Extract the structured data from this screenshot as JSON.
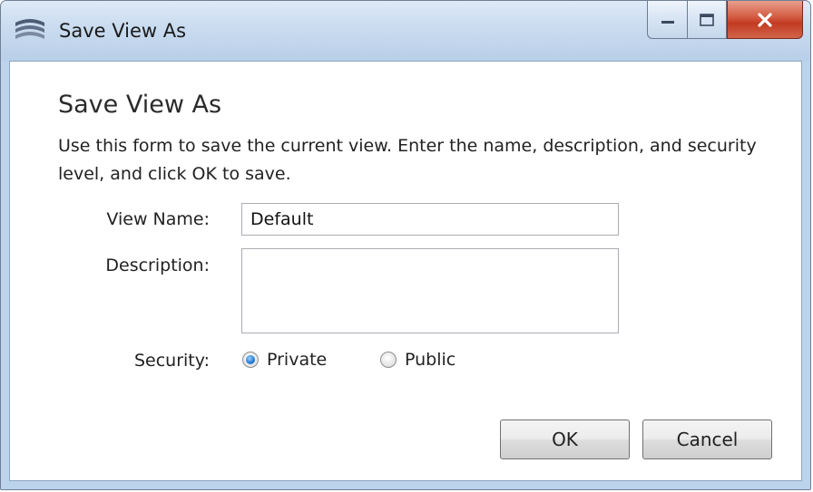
{
  "window": {
    "title": "Save View As",
    "icon": "app-logo-icon",
    "caption_buttons": [
      "minimize-icon",
      "maximize-icon",
      "close-icon"
    ],
    "close_button_color": "#c8452b"
  },
  "form": {
    "heading": "Save View As",
    "intro": "Use this form to save the current view. Enter the name, description, and security level, and click OK to save.",
    "view_name_label": "View Name:",
    "view_name_value": "Default",
    "description_label": "Description:",
    "description_value": "",
    "security_label": "Security:",
    "security_options": [
      {
        "label": "Private",
        "selected": true
      },
      {
        "label": "Public",
        "selected": false
      }
    ]
  },
  "buttons": {
    "ok": "OK",
    "cancel": "Cancel"
  }
}
